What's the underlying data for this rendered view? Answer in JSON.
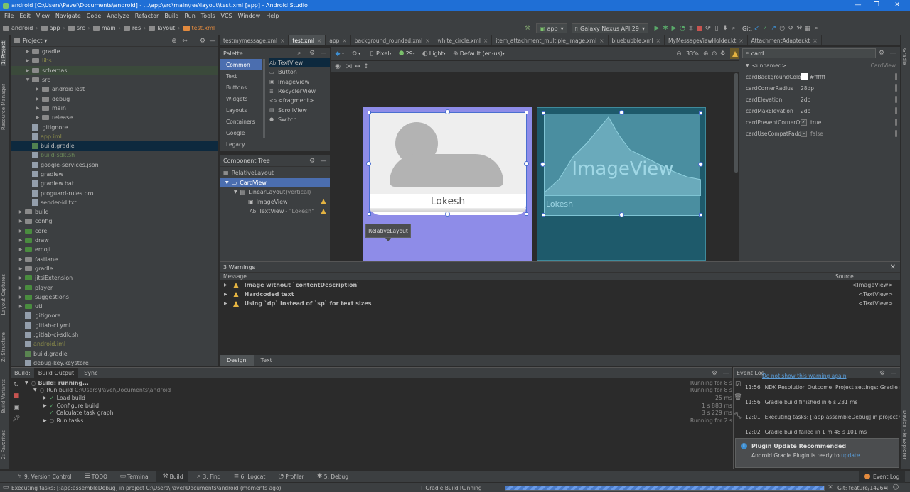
{
  "window": {
    "title": "android [C:\\Users\\Pavel\\Documents\\android] - ...\\app\\src\\main\\res\\layout\\test.xml [app] - Android Studio"
  },
  "menu": [
    "File",
    "Edit",
    "View",
    "Navigate",
    "Code",
    "Analyze",
    "Refactor",
    "Build",
    "Run",
    "Tools",
    "VCS",
    "Window",
    "Help"
  ],
  "breadcrumb": [
    "android",
    "app",
    "src",
    "main",
    "res",
    "layout",
    "test.xml"
  ],
  "toolbar": {
    "config": "app",
    "device": "Galaxy Nexus API 29",
    "git_label": "Git:"
  },
  "project_panel": {
    "title": "Project",
    "rows": [
      {
        "label": "gradle",
        "type": "folder"
      },
      {
        "label": "libs",
        "type": "folder"
      },
      {
        "label": "schemas",
        "type": "folder"
      },
      {
        "label": "src",
        "type": "folder"
      },
      {
        "label": "androidTest",
        "type": "folder"
      },
      {
        "label": "debug",
        "type": "folder"
      },
      {
        "label": "main",
        "type": "folder"
      },
      {
        "label": "release",
        "type": "folder"
      },
      {
        "label": ".gitignore",
        "type": "file"
      },
      {
        "label": "app.iml",
        "type": "file"
      },
      {
        "label": "build.gradle",
        "type": "file"
      },
      {
        "label": "build-sdk.sh",
        "type": "file"
      },
      {
        "label": "google-services.json",
        "type": "file"
      },
      {
        "label": "gradlew",
        "type": "file"
      },
      {
        "label": "gradlew.bat",
        "type": "file"
      },
      {
        "label": "proguard-rules.pro",
        "type": "file"
      },
      {
        "label": "sender-id.txt",
        "type": "file"
      },
      {
        "label": "build",
        "type": "folder"
      },
      {
        "label": "config",
        "type": "folder"
      },
      {
        "label": "core",
        "type": "folder"
      },
      {
        "label": "draw",
        "type": "folder"
      },
      {
        "label": "emoji",
        "type": "folder"
      },
      {
        "label": "fastlane",
        "type": "folder"
      },
      {
        "label": "gradle",
        "type": "folder"
      },
      {
        "label": "jitsiExtension",
        "type": "folder"
      },
      {
        "label": "player",
        "type": "folder"
      },
      {
        "label": "suggestions",
        "type": "folder"
      },
      {
        "label": "util",
        "type": "folder"
      },
      {
        "label": ".gitignore",
        "type": "file"
      },
      {
        "label": ".gitlab-ci.yml",
        "type": "file"
      },
      {
        "label": ".gitlab-ci-sdk.sh",
        "type": "file"
      },
      {
        "label": "android.iml",
        "type": "file"
      },
      {
        "label": "build.gradle",
        "type": "file"
      },
      {
        "label": "debug-key.keystore",
        "type": "file"
      }
    ]
  },
  "left_strip": [
    "1: Project",
    "Resource Manager",
    "Layout Captures",
    "Z: Structure",
    "Build Variants",
    "2: Favorites"
  ],
  "right_strip": [
    "Gradle",
    "Device File Explorer"
  ],
  "editor_tabs": [
    "testmymessage.xml",
    "test.xml",
    "app",
    "background_rounded.xml",
    "white_circle.xml",
    "item_attachment_multiple_image.xml",
    "bluebubble.xml",
    "MyMessageViewHolder.kt",
    "AttachmentAdapter.kt"
  ],
  "palette": {
    "title": "Palette",
    "categories": [
      "Common",
      "Text",
      "Buttons",
      "Widgets",
      "Layouts",
      "Containers",
      "Google",
      "Legacy"
    ],
    "items": [
      {
        "icon": "Ab",
        "label": "TextView"
      },
      {
        "icon": "▭",
        "label": "Button"
      },
      {
        "icon": "▣",
        "label": "ImageView"
      },
      {
        "icon": "≣",
        "label": "RecyclerView"
      },
      {
        "icon": "<>",
        "label": "<fragment>"
      },
      {
        "icon": "▤",
        "label": "ScrollView"
      },
      {
        "icon": "●",
        "label": "Switch"
      }
    ]
  },
  "component_tree": {
    "title": "Component Tree",
    "nodes": [
      {
        "label": "RelativeLayout",
        "suffix": "",
        "warn": false
      },
      {
        "label": "CardView",
        "suffix": "",
        "warn": false
      },
      {
        "label": "LinearLayout",
        "suffix": "(vertical)",
        "warn": false
      },
      {
        "label": "ImageView",
        "suffix": "",
        "warn": true
      },
      {
        "label": "TextView",
        "suffix": "- \"Lokesh\"",
        "warn": true
      }
    ]
  },
  "design_toolbar": {
    "device": "Pixel",
    "api": "29",
    "theme": "Light",
    "locale": "Default (en-us)",
    "zoom": "33%"
  },
  "canvas": {
    "name_text": "Lokesh",
    "image_label": "ImageView",
    "tooltip": "RelativeLayout"
  },
  "attributes": {
    "search": "card",
    "id_label": "<unnamed>",
    "type_label": "CardView",
    "rows": [
      {
        "key": "cardBackgroundColor",
        "value": "#ffffff",
        "kind": "color"
      },
      {
        "key": "cardCornerRadius",
        "value": "28dp",
        "kind": "text"
      },
      {
        "key": "cardElevation",
        "value": "2dp",
        "kind": "text"
      },
      {
        "key": "cardMaxElevation",
        "value": "2dp",
        "kind": "text"
      },
      {
        "key": "cardPreventCornerOverlap",
        "value": "true",
        "kind": "check"
      },
      {
        "key": "cardUseCompatPadding",
        "value": "false",
        "kind": "uncheck"
      }
    ]
  },
  "warnings": {
    "title": "3 Warnings",
    "col_message": "Message",
    "col_source": "Source",
    "rows": [
      {
        "msg": "Image without `contentDescription`",
        "src": "<ImageView>"
      },
      {
        "msg": "Hardcoded text",
        "src": "<TextView>"
      },
      {
        "msg": "Using `dp` instead of `sp` for text sizes",
        "src": "<TextView>"
      }
    ]
  },
  "design_tabs": [
    "Design",
    "Text"
  ],
  "build": {
    "tabs": [
      "Build:",
      "Build Output",
      "Sync"
    ],
    "rows": [
      {
        "label": "Build: running...",
        "time": "Running for 8 s",
        "indent": 0,
        "check": false
      },
      {
        "label": "Run build",
        "path": "C:\\Users\\Pavel\\Documents\\android",
        "time": "Running for 8 s",
        "indent": 1,
        "check": false
      },
      {
        "label": "Load build",
        "time": "25 ms",
        "indent": 2,
        "check": true
      },
      {
        "label": "Configure build",
        "time": "1 s 883 ms",
        "indent": 2,
        "check": true
      },
      {
        "label": "Calculate task graph",
        "time": "3 s 229 ms",
        "indent": 2,
        "check": true
      },
      {
        "label": "Run tasks",
        "time": "Running for 2 s",
        "indent": 2,
        "check": false
      }
    ]
  },
  "event_log": {
    "title": "Event Log",
    "top_link": "Do not show this warning again",
    "rows": [
      {
        "time": "11:56",
        "text": "NDK Resolution Outcome: Project settings: Gradle mo"
      },
      {
        "time": "11:56",
        "text": "Gradle build finished in 6 s 231 ms"
      },
      {
        "time": "12:01",
        "text": "Executing tasks: [:app:assembleDebug] in project C:\\U"
      },
      {
        "time": "12:02",
        "text": "Gradle build failed in 1 m 48 s 101 ms"
      }
    ]
  },
  "popup": {
    "title": "Plugin Update Recommended",
    "body": "Android Gradle Plugin is ready to ",
    "link": "update."
  },
  "bottom_tabs": [
    "9: Version Control",
    "TODO",
    "Terminal",
    "Build",
    "3: Find",
    "6: Logcat",
    "Profiler",
    "5: Debug"
  ],
  "event_log_tab": "Event Log",
  "status": {
    "left": "Executing tasks: [:app:assembleDebug] in project C:\\Users\\Pavel\\Documents\\android (moments ago)",
    "center": "Gradle Build Running",
    "right": "Git: feature/1426 ÷"
  },
  "colors": {
    "accent": "#4b6eaf",
    "title_bar": "#1f6fd6",
    "warning": "#e3b341",
    "card_purple": "#8e8ce8",
    "blueprint": "#1e5a6b"
  }
}
